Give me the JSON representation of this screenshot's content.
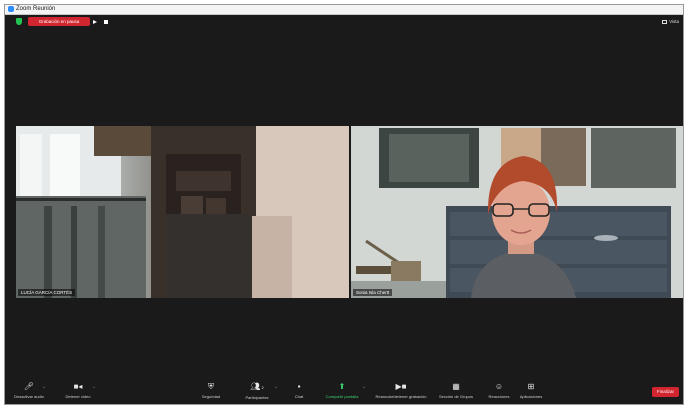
{
  "window": {
    "title": "Zoom Reunión"
  },
  "topbar": {
    "recording_label": "Grabación en pausa",
    "view_label": "Vista"
  },
  "participants": [
    {
      "name": "LUCÍA GARCÍA CORTÉS"
    },
    {
      "name": "Sonia Isla Chertt"
    }
  ],
  "toolbar": {
    "audio_label": "Desactivar audio",
    "video_label": "Detener video",
    "security_label": "Seguridad",
    "participants_label": "Participantes",
    "participants_count": "2",
    "chat_label": "Chat",
    "share_label": "Compartir pantalla",
    "recording_label": "Reanudar/detener grabación",
    "breakout_label": "Sección de Grupos",
    "reactions_label": "Reacciones",
    "apps_label": "Aplicaciones",
    "end_label": "Finalizar"
  },
  "colors": {
    "recording": "#d1262f",
    "share": "#3bd16f",
    "end": "#d1262f",
    "security": "#23c552"
  }
}
